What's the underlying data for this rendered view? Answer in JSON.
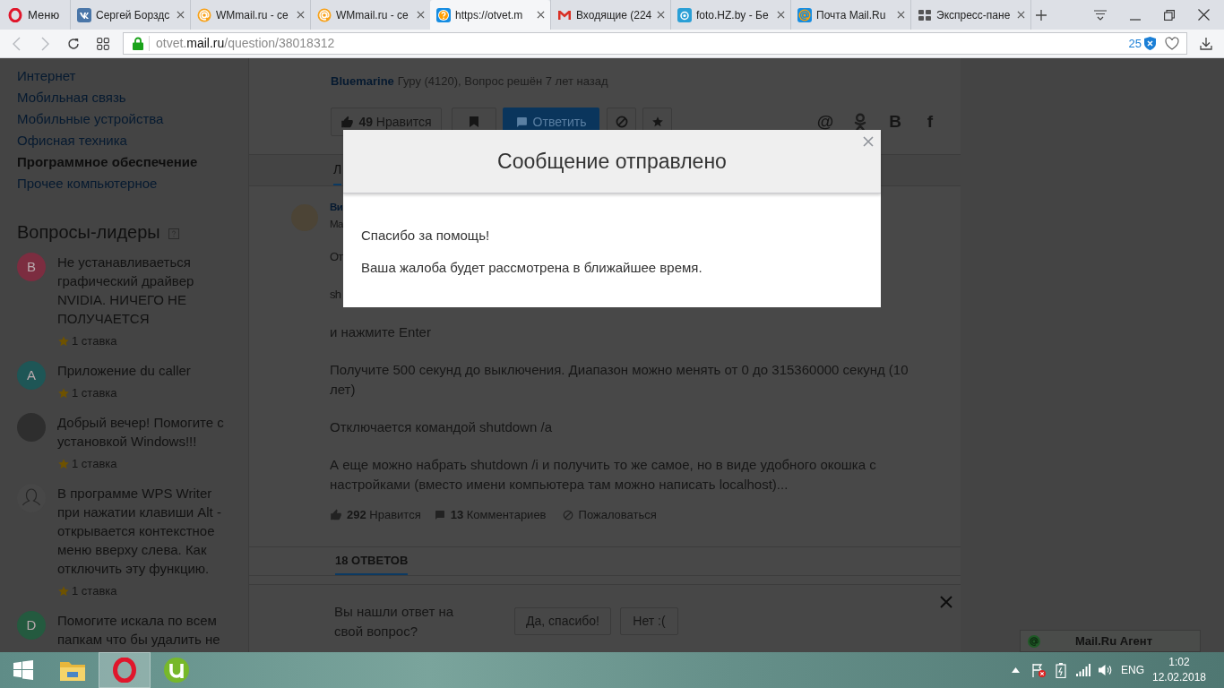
{
  "browser": {
    "menu_label": "Меню",
    "tabs": [
      {
        "kind": "vk",
        "title": "Сергей Борздс",
        "selected": false
      },
      {
        "kind": "wmmail",
        "title": "WMmail.ru - се",
        "selected": false
      },
      {
        "kind": "wmmail",
        "title": "WMmail.ru - се",
        "selected": false
      },
      {
        "kind": "otvet",
        "title": "https://otvet.m",
        "selected": true
      },
      {
        "kind": "gmail",
        "title": "Входящие (224",
        "selected": false
      },
      {
        "kind": "foto",
        "title": "foto.HZ.by - Бе",
        "selected": false
      },
      {
        "kind": "mailru",
        "title": "Почта Mail.Ru",
        "selected": false
      },
      {
        "kind": "speeddial",
        "title": "Экспресс-пане",
        "selected": false
      }
    ],
    "address": {
      "subdomain": "otvet.",
      "domain": "mail.ru",
      "path": "/question/38018312",
      "blocked_count": "25"
    }
  },
  "sidebar": {
    "categories": [
      {
        "label": "Интернет",
        "selected": false
      },
      {
        "label": "Мобильная связь",
        "selected": false
      },
      {
        "label": "Мобильные устройства",
        "selected": false
      },
      {
        "label": "Офисная техника",
        "selected": false
      },
      {
        "label": "Программное обеспечение",
        "selected": true
      },
      {
        "label": "Прочее компьютерное",
        "selected": false
      }
    ],
    "leaders_title": "Вопросы-лидеры",
    "leaders": [
      {
        "kind": "letter",
        "letter": "B",
        "color": "#7c2d40",
        "question": "Не устанавливаеться графический драйвер NVIDIA. НИЧЕГО НЕ ПОЛУЧАЕТСЯ",
        "bet": "1 ставка"
      },
      {
        "kind": "letter",
        "letter": "A",
        "color": "#1e5656",
        "question": "Приложение du caller",
        "bet": "1 ставка"
      },
      {
        "kind": "photo",
        "question": "Добрый вечер! Помогите с установкой Windows!!!",
        "bet": "1 ставка"
      },
      {
        "kind": "silhouette",
        "question": "В программе WPS Writer при нажатии клавиши Alt - открывается контекстное меню вверху слева. Как отключить эту функцию.",
        "bet": "1 ставка"
      },
      {
        "kind": "letter",
        "letter": "D",
        "color": "#245a3f",
        "question": "Помогите искала по всем папкам что бы удалить не"
      }
    ]
  },
  "question": {
    "author": "Bluemarine",
    "meta": "Гуру (4120), Вопрос решён 7 лет назад",
    "like_button": "**49** Нравится",
    "reply_button": "Ответить",
    "share": [
      {
        "kind": "glyph",
        "text": "@"
      },
      {
        "kind": "ok"
      },
      {
        "kind": "glyph",
        "text": "В"
      },
      {
        "kind": "glyph",
        "text": "f"
      }
    ]
  },
  "answer_tabs": [
    {
      "label": "Л",
      "selected": true
    }
  ],
  "answer": {
    "author": "Ви",
    "meta": "Ма",
    "paragraphs": [
      {
        "kind": "clipped",
        "text": "От"
      },
      {
        "kind": "clipped",
        "text": "sh"
      },
      {
        "kind": "full",
        "text": "и нажмите Enter"
      },
      {
        "kind": "full",
        "text": "Получите 500 секунд до выключения. Диапазон можно менять от 0 до 315360000 секунд (10 лет)"
      },
      {
        "kind": "full",
        "text": "Отключается командой shutdown /a"
      },
      {
        "kind": "full",
        "text": "А еще можно набрать shutdown /i и получить то же самое, но в виде удобного окошка с настройками (вместо имени компьютера там можно написать localhost)..."
      }
    ],
    "likes": "**292** Нравится",
    "comments": "**13** Комментариев",
    "report": "Пожаловаться"
  },
  "answers_count_tab": {
    "label": "18 ОТВЕТОВ",
    "selected": true
  },
  "feedback": {
    "question": "Вы нашли ответ на свой вопрос?",
    "buttons": [
      "Да, спасибо!",
      "Нет :("
    ]
  },
  "agent": {
    "label": "Mail.Ru Агент"
  },
  "modal": {
    "title": "Сообщение отправлено",
    "lines": [
      "Спасибо за помощь!",
      "Ваша жалоба будет рассмотрена в ближайшее время."
    ]
  },
  "taskbar": {
    "apps": [
      {
        "kind": "explorer",
        "selected": false
      },
      {
        "kind": "opera",
        "selected": true
      },
      {
        "kind": "utorrent",
        "selected": false
      }
    ],
    "language": "ENG",
    "time": "1:02",
    "date": "12.02.2018"
  }
}
